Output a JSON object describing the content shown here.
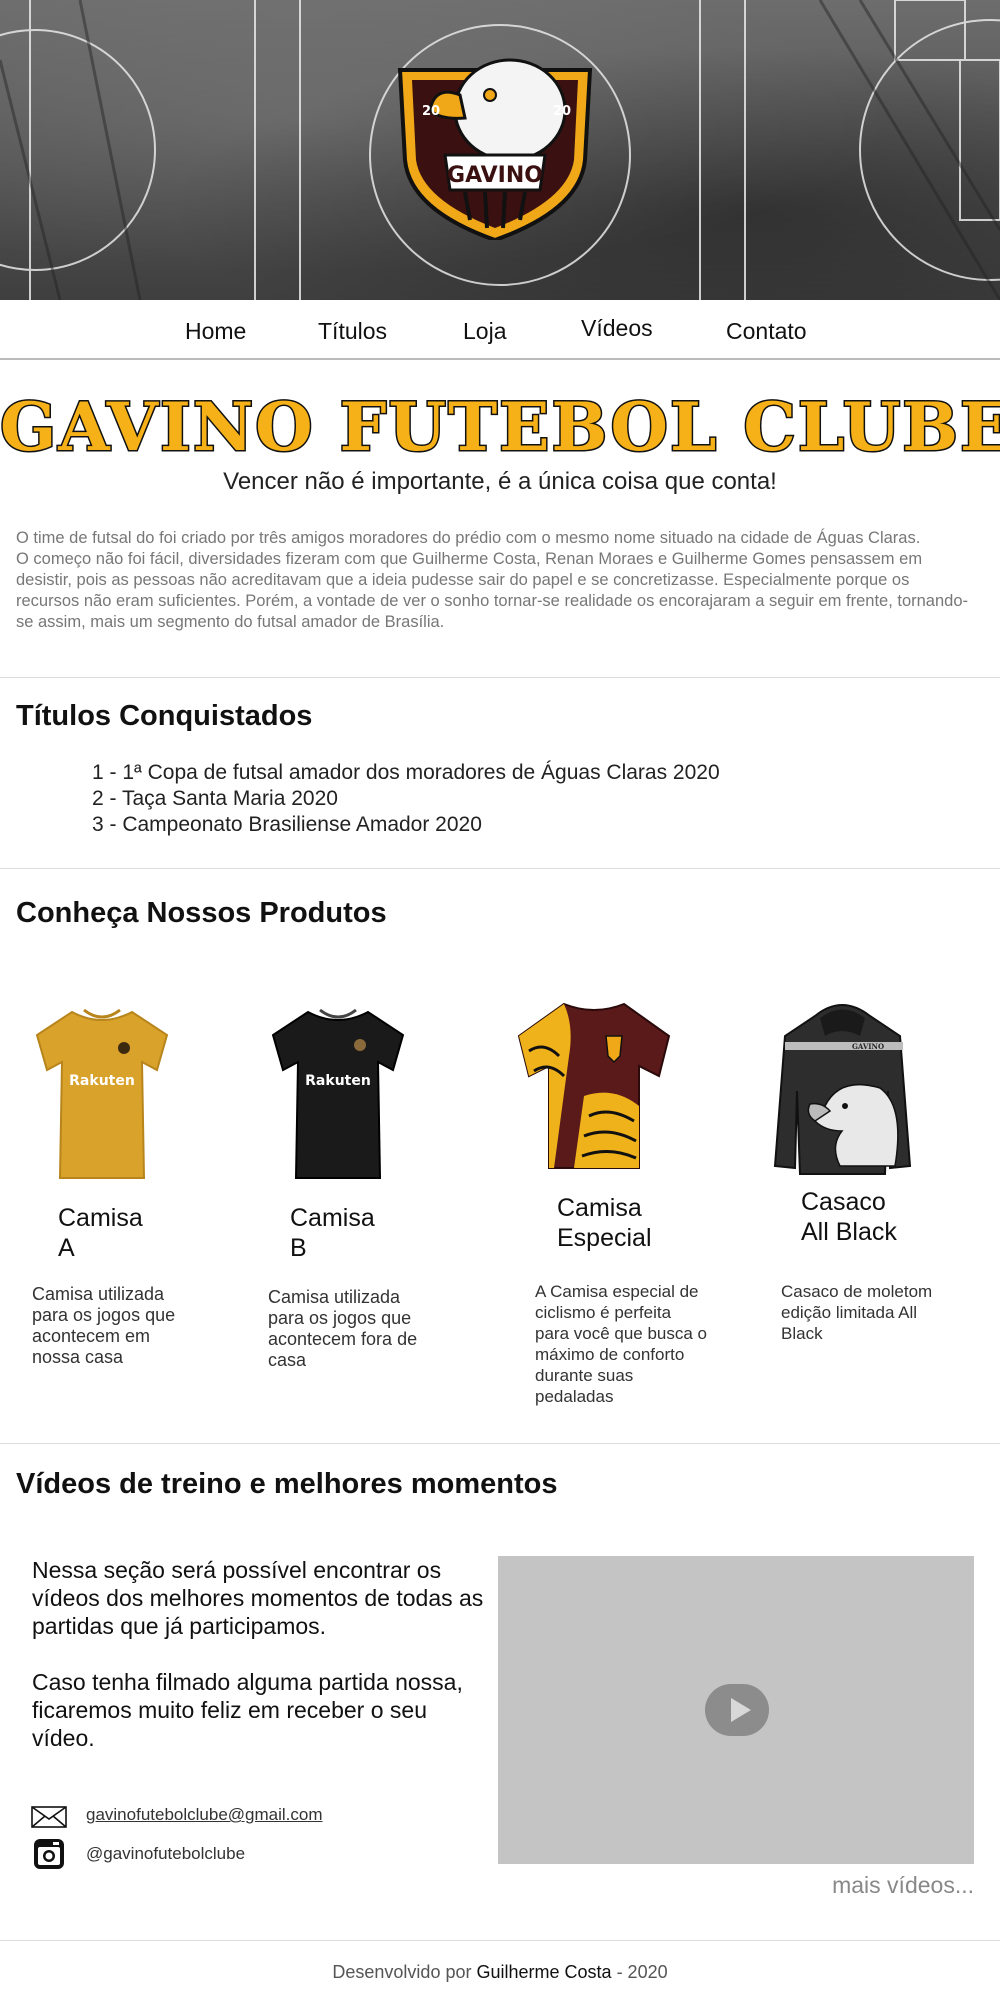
{
  "hero": {
    "logo_text": "GAVINO",
    "logo_year_left": "20",
    "logo_year_right": "20"
  },
  "nav": {
    "items": [
      {
        "label": "Home"
      },
      {
        "label": "Títulos"
      },
      {
        "label": "Loja"
      },
      {
        "label": "Vídeos"
      },
      {
        "label": "Contato"
      }
    ]
  },
  "header": {
    "title": "GAVINO FUTEBOL CLUBE",
    "slogan": "Vencer não é importante, é a única coisa que conta!"
  },
  "intro": {
    "p1": "O time de futsal do  foi criado por três amigos moradores do prédio com o mesmo nome situado na cidade de Águas Claras.",
    "p2": "O começo não foi fácil, diversidades fizeram com que Guilherme Costa, Renan Moraes e Guilherme Gomes pensassem em desistir, pois as pessoas não acreditavam que a ideia pudesse sair do papel e se concretizasse. Especialmente porque os recursos não eram suficientes. Porém, a vontade de ver o sonho tornar-se realidade os encorajaram a seguir em frente, tornando-se assim, mais um segmento do futsal amador de Brasília."
  },
  "titles": {
    "heading": "Títulos Conquistados",
    "items": [
      "1 - 1ª Copa de futsal amador dos moradores de Águas Claras 2020",
      "2 - Taça Santa Maria 2020",
      "3 -  Campeonato Brasiliense Amador 2020"
    ]
  },
  "products": {
    "heading": "Conheça Nossos Produtos",
    "items": [
      {
        "name_line1": "Camisa",
        "name_line2": "A",
        "description": "Camisa utilizada para os jogos que acontecem em nossa casa",
        "shirt_text": "Rakuten",
        "color": "#d9a22a"
      },
      {
        "name_line1": "Camisa",
        "name_line2": "B",
        "description": "Camisa utilizada para os jogos que acontecem fora de casa",
        "shirt_text": "Rakuten",
        "color": "#1a1a1a"
      },
      {
        "name_line1": "Camisa",
        "name_line2": "Especial",
        "description": "A Camisa especial de ciclismo  é perfeita para você que busca o máximo de conforto durante suas pedaladas",
        "color": "#5a1a1a"
      },
      {
        "name_line1": "Casaco",
        "name_line2": "All Black",
        "description": "Casaco de moletom edição limitada All Black",
        "hoodie_text": "GAVINO",
        "color": "#2d2d2d"
      }
    ]
  },
  "videos": {
    "heading": "Vídeos de treino e melhores momentos",
    "text1": "Nessa seção será possível encontrar os vídeos dos melhores momentos de todas as partidas que já participamos.",
    "text2": "Caso tenha filmado alguma partida nossa, ficaremos muito feliz em receber o seu vídeo.",
    "more_label": "mais vídeos..."
  },
  "contact": {
    "email": "gavinofutebolclube@gmail.com",
    "instagram": "@gavinofutebolclube"
  },
  "footer": {
    "prefix": "Desenvolvido por",
    "author": "Guilherme Costa",
    "suffix": "- 2020"
  },
  "colors": {
    "brand_yellow": "#f5b117",
    "logo_dark": "#3b1010",
    "video_placeholder": "#c4c4c4"
  }
}
